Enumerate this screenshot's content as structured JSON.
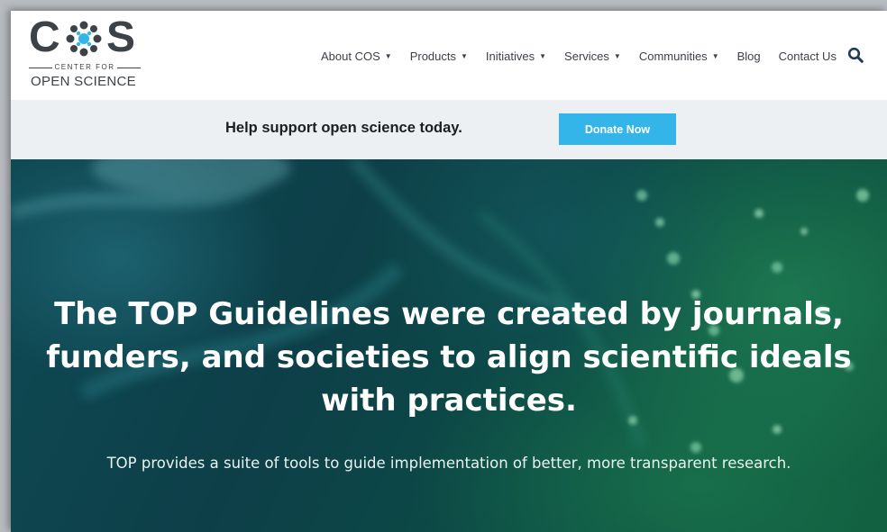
{
  "header": {
    "logo": {
      "wordmark_left": "C",
      "wordmark_right": "S",
      "tagline_top": "CENTER FOR",
      "tagline_bottom": "OPEN SCIENCE"
    },
    "nav": [
      {
        "label": "About COS",
        "has_dropdown": true
      },
      {
        "label": "Products",
        "has_dropdown": true
      },
      {
        "label": "Initiatives",
        "has_dropdown": true
      },
      {
        "label": "Services",
        "has_dropdown": true
      },
      {
        "label": "Communities",
        "has_dropdown": true
      },
      {
        "label": "Blog",
        "has_dropdown": false
      },
      {
        "label": "Contact Us",
        "has_dropdown": false
      }
    ],
    "search_icon": "search-icon"
  },
  "donation": {
    "text": "Help support open science today.",
    "button_label": "Donate Now"
  },
  "hero": {
    "title": "The TOP Guidelines were created by journals, funders, and societies to align scientific ideals with practices.",
    "subtitle": "TOP provides a suite of tools to guide implementation of better, more transparent research."
  },
  "colors": {
    "accent": "#33b5e9",
    "logo_text": "#3d4249",
    "donate_bar_bg": "#edf0f2",
    "hero_dark": "#0d3f48",
    "hero_green": "#0f5a3e"
  }
}
